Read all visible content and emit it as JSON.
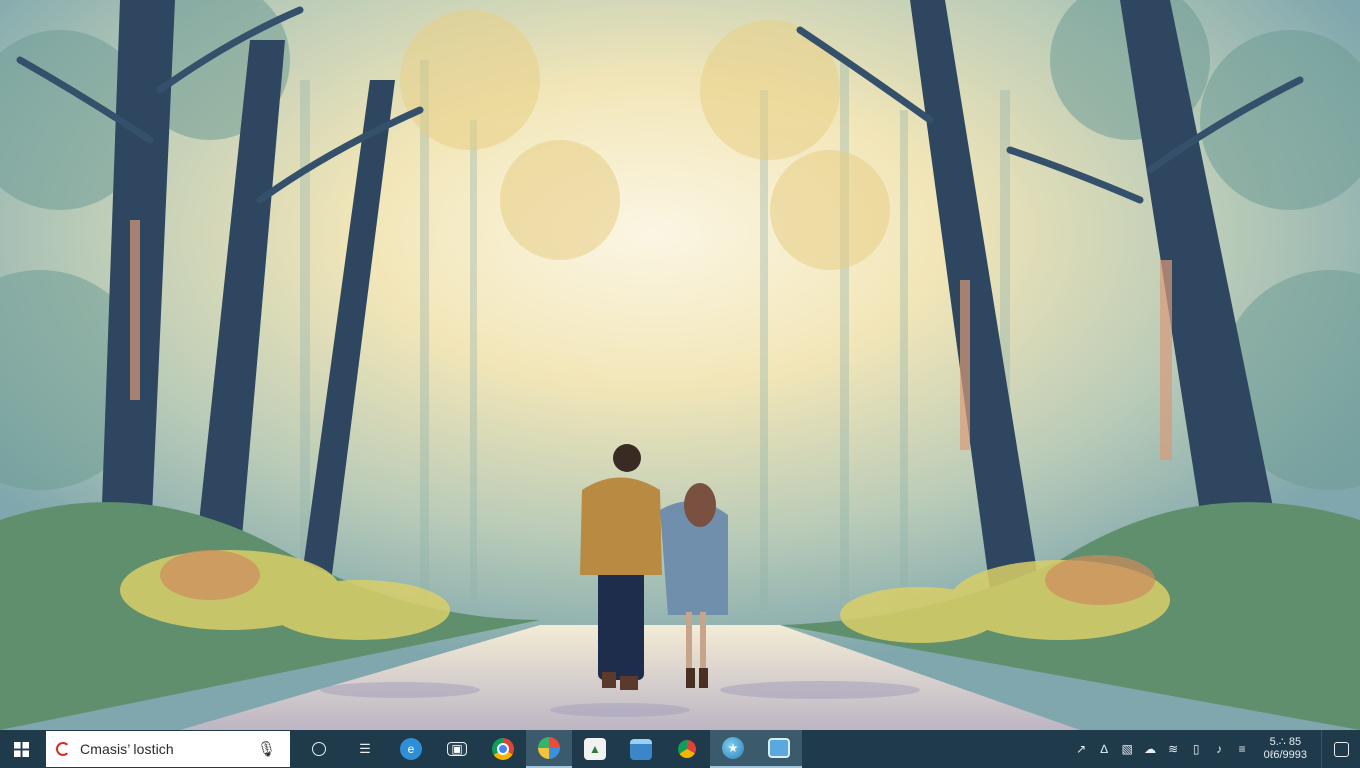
{
  "taskbar": {
    "search": {
      "value": "Cmasis’ lostich"
    },
    "pinned": [
      {
        "icon": "task-view-icon"
      },
      {
        "icon": "store-icon"
      },
      {
        "icon": "edge-icon"
      },
      {
        "icon": "media-icon"
      },
      {
        "icon": "chrome-icon"
      },
      {
        "icon": "paint-icon"
      },
      {
        "icon": "app-icon"
      },
      {
        "icon": "explorer-icon"
      },
      {
        "icon": "chrome-alt-icon"
      },
      {
        "icon": "globe-icon"
      },
      {
        "icon": "photos-icon"
      }
    ],
    "clock": {
      "time": "5.∴ 85",
      "date": "0ℓ6/9993"
    }
  },
  "colors": {
    "taskbar_bg": "#1f3a4a",
    "active_item": "#3b5a6b",
    "search_bg": "#ffffff"
  }
}
